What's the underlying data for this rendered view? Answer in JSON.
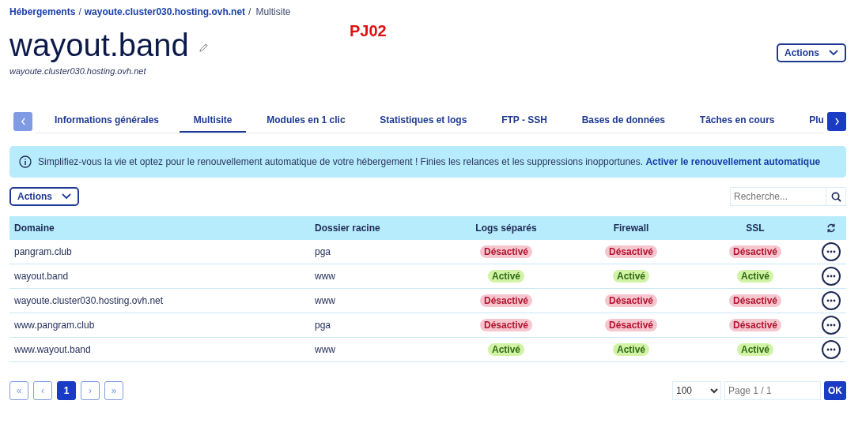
{
  "breadcrumb": [
    {
      "label": "Hébergements",
      "link": true,
      "separator": "/"
    },
    {
      "label": "wayoute.cluster030.hosting.ovh.net",
      "link": true,
      "separator": "/"
    },
    {
      "label": "Multisite",
      "link": false
    }
  ],
  "annotation": "PJ02",
  "header": {
    "title": "wayout.band",
    "subtitle": "wayoute.cluster030.hosting.ovh.net",
    "actions": "Actions"
  },
  "tabs": {
    "prev_disabled": true,
    "next_disabled": false,
    "items": [
      {
        "label": "Informations générales",
        "selected": false
      },
      {
        "label": "Multisite",
        "selected": true
      },
      {
        "label": "Modules en 1 clic",
        "selected": false
      },
      {
        "label": "Statistiques et logs",
        "selected": false
      },
      {
        "label": "FTP - SSH",
        "selected": false
      },
      {
        "label": "Bases de données",
        "selected": false
      },
      {
        "label": "Tâches en cours",
        "selected": false
      },
      {
        "label": "Plu",
        "selected": false
      }
    ]
  },
  "banner": {
    "text": "Simplifiez-vous la vie et optez pour le renouvellement automatique de votre hébergement ! Finies les relances et les suppressions inopportunes.",
    "link": "Activer le renouvellement automatique"
  },
  "toolbar": {
    "actions": "Actions",
    "search": {
      "placeholder": "Recherche..."
    }
  },
  "table": {
    "columns": [
      "Domaine",
      "Dossier racine",
      "Logs séparés",
      "Firewall",
      "SSL"
    ],
    "rows": [
      {
        "domain": "pangram.club",
        "folder": "pga",
        "statuses": [
          {
            "label": "Désactivé",
            "on": false
          },
          {
            "label": "Désactivé",
            "on": false
          },
          {
            "label": "Désactivé",
            "on": false
          }
        ]
      },
      {
        "domain": "wayout.band",
        "folder": "www",
        "statuses": [
          {
            "label": "Activé",
            "on": true
          },
          {
            "label": "Activé",
            "on": true
          },
          {
            "label": "Activé",
            "on": true
          }
        ]
      },
      {
        "domain": "wayoute.cluster030.hosting.ovh.net",
        "folder": "www",
        "statuses": [
          {
            "label": "Désactivé",
            "on": false
          },
          {
            "label": "Désactivé",
            "on": false
          },
          {
            "label": "Désactivé",
            "on": false
          }
        ]
      },
      {
        "domain": "www.pangram.club",
        "folder": "pga",
        "statuses": [
          {
            "label": "Désactivé",
            "on": false
          },
          {
            "label": "Désactivé",
            "on": false
          },
          {
            "label": "Désactivé",
            "on": false
          }
        ]
      },
      {
        "domain": "www.wayout.band",
        "folder": "www",
        "statuses": [
          {
            "label": "Activé",
            "on": true
          },
          {
            "label": "Activé",
            "on": true
          },
          {
            "label": "Activé",
            "on": true
          }
        ]
      }
    ]
  },
  "pagination": {
    "buttons": [
      {
        "label": "«",
        "selected": false
      },
      {
        "label": "‹",
        "selected": false
      },
      {
        "label": "1",
        "selected": true
      },
      {
        "label": "›",
        "selected": false
      },
      {
        "label": "»",
        "selected": false
      }
    ],
    "page_size": "100",
    "page_field": {
      "placeholder": "Page 1 / 1"
    },
    "ok": "OK"
  }
}
